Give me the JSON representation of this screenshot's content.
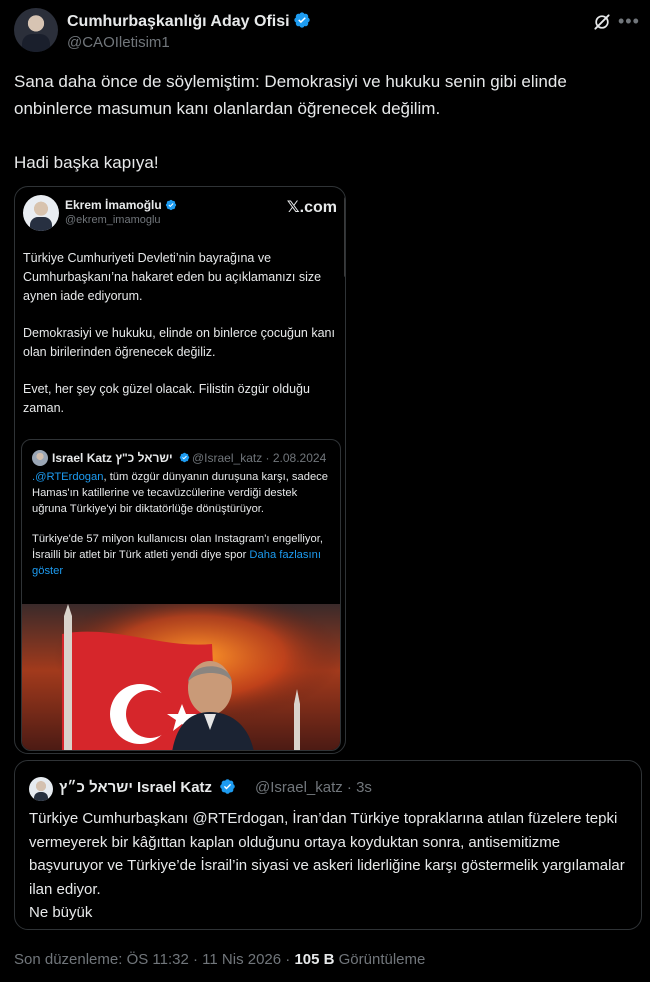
{
  "author": {
    "name": "Cumhurbaşkanlığı Aday Ofisi",
    "handle": "@CAOIletisim1"
  },
  "tweet": {
    "line1": "Sana daha önce de söylemiştim: Demokrasiyi ve hukuku senin gibi elinde onbinlerce masumun kanı olanlardan öğrenecek değilim.",
    "line2": "Hadi başka kapıya!"
  },
  "embedded_post": {
    "name": "Ekrem İmamoğlu",
    "handle": "@ekrem_imamoglu",
    "source_label": "𝕏.com",
    "paragraphs": [
      "Türkiye Cumhuriyeti Devleti’nin bayrağına ve Cumhurbaşkanı’na hakaret eden bu açıklamanızı size aynen iade ediyorum.",
      "Demokrasiyi ve hukuku, elinde on binlerce çocuğun kanı olan birilerinden öğrenecek değiliz.",
      "Evet, her şey çok güzel olacak. Filistin özgür olduğu zaman."
    ],
    "quoted": {
      "name": "Israel Katz ישראל כ\"ץ",
      "handle": "@Israel_katz · 2.08.2024",
      "mention": ".@RTErdogan",
      "text1_rest": ", tüm özgür dünyanın duruşuna karşı, sadece Hamas'ın katillerine ve tecavüzcülerine verdiği destek uğruna Türkiye'yi bir diktatörlüğe dönüştürüyor.",
      "text2": "Türkiye'de 57 milyon kullanıcısı olan Instagram'ı engelliyor, İsrailli bir atlet bir Türk atleti yendi diye spor ",
      "show_more": "Daha fazlasını göster"
    }
  },
  "quote_tweet": {
    "name": "ישראל כ״ץ Israel Katz",
    "handle": "@Israel_katz · 3s",
    "text_before": "Türkiye Cumhurbaşkanı ",
    "mention": "@RTErdogan",
    "text_after": ", İran’dan Türkiye topraklarına atılan füzelere tepki vermeyerek bir kâğıttan kaplan olduğunu ortaya koyduktan sonra, antisemitizme başvuruyor ve Türkiye’de İsrail’in siyasi ve askeri liderliğine karşı göstermelik yargılamalar ilan ediyor.",
    "text_end": "Ne büyük"
  },
  "footer": {
    "edited": "Son düzenleme: ÖS 11:32 · 11 Nis 2026 · ",
    "views_count": "105 B",
    "views_label": " Görüntüleme"
  },
  "colors": {
    "background": "#000000",
    "text": "#e7e9ea",
    "muted": "#71767b",
    "link": "#1d9bf0",
    "border": "#2f3336"
  },
  "icons": [
    "verified-badge-icon",
    "grok-icon",
    "more-icon"
  ]
}
